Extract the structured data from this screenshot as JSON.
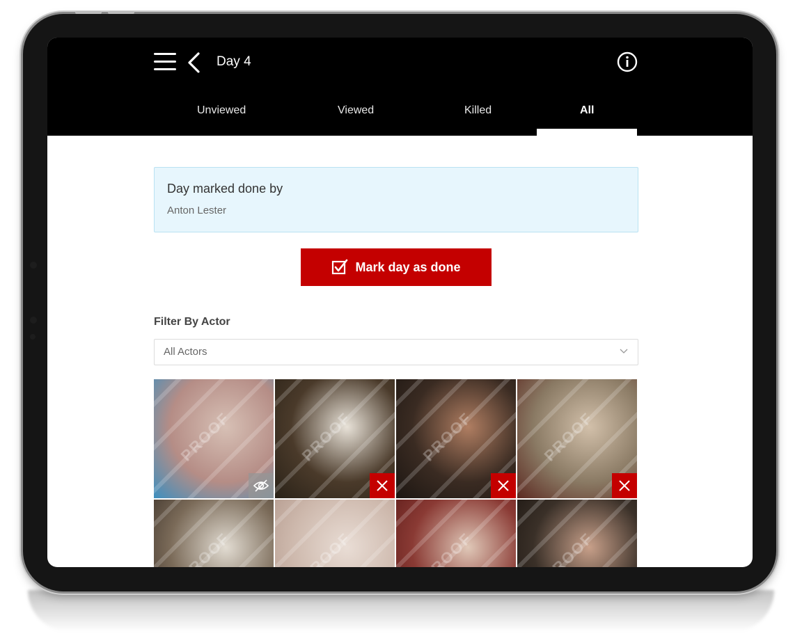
{
  "header": {
    "title": "Day 4",
    "icons": [
      "menu-icon",
      "back-icon",
      "info-icon"
    ]
  },
  "tabs": [
    {
      "label": "Unviewed",
      "active": false
    },
    {
      "label": "Viewed",
      "active": false
    },
    {
      "label": "Killed",
      "active": false
    },
    {
      "label": "All",
      "active": true
    }
  ],
  "notice": {
    "title": "Day marked done by",
    "name": "Anton Lester"
  },
  "actions": {
    "mark_done_label": "Mark day as done"
  },
  "filter": {
    "label": "Filter By Actor",
    "selected": "All Actors"
  },
  "thumbnails": [
    {
      "status": "hidden",
      "watermark": "PROOF",
      "colors": [
        "#b58d86",
        "#d7c0b5",
        "#3d8fbf"
      ]
    },
    {
      "status": "killed",
      "watermark": "PROOF",
      "colors": [
        "#4a3a2a",
        "#e8e2d8",
        "#2a2218"
      ]
    },
    {
      "status": "killed",
      "watermark": "PROOF",
      "colors": [
        "#3a2b22",
        "#b07e62",
        "#1c1612"
      ]
    },
    {
      "status": "killed",
      "watermark": "PROOF",
      "colors": [
        "#8a7a64",
        "#d2c0aa",
        "#5c2a22"
      ]
    },
    {
      "status": "none",
      "watermark": "PROOF",
      "colors": [
        "#7a6a58",
        "#e2dcd2",
        "#3a3028"
      ]
    },
    {
      "status": "none",
      "watermark": "PROOF",
      "colors": [
        "#cdb8ac",
        "#e9ddd5",
        "#b0968a"
      ]
    },
    {
      "status": "none",
      "watermark": "PROOF",
      "colors": [
        "#8a3a34",
        "#e0c8b8",
        "#5a1a18"
      ]
    },
    {
      "status": "none",
      "watermark": "PROOF",
      "colors": [
        "#3a3028",
        "#c8a08a",
        "#1a1410"
      ]
    }
  ],
  "colors": {
    "accent_red": "#c40000",
    "notice_bg": "#e7f6fd",
    "header_bg": "#000000"
  }
}
